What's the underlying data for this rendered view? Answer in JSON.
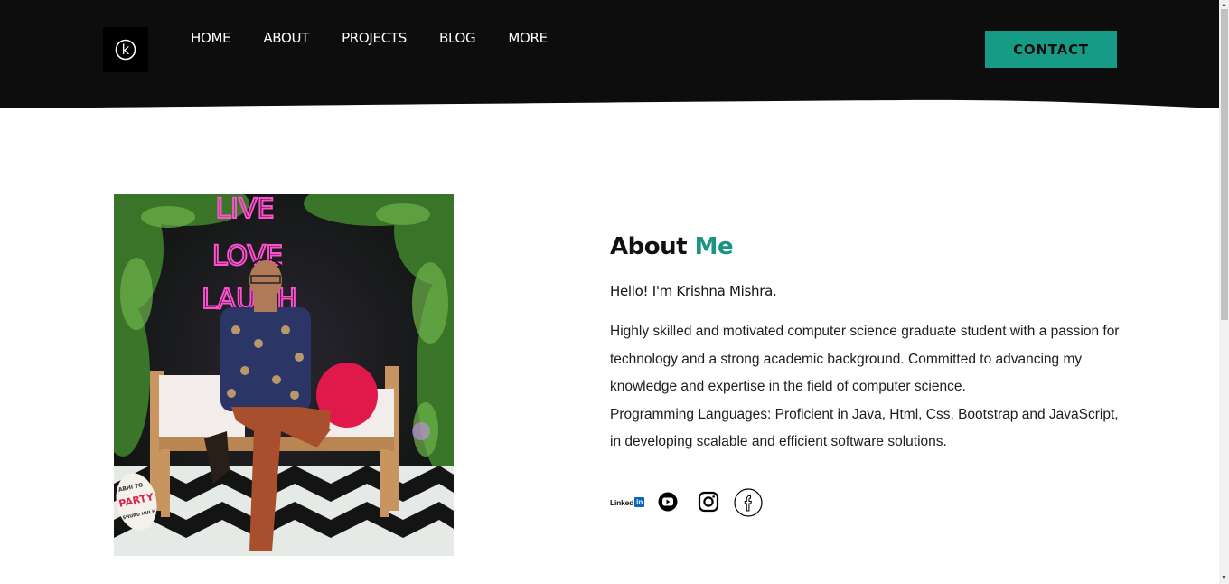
{
  "nav": {
    "logo_letter": "k",
    "items": [
      "HOME",
      "ABOUT",
      "PROJECTS",
      "BLOG",
      "MORE"
    ],
    "contact_label": "CONTACT"
  },
  "about": {
    "title_main": "About",
    "title_accent": "Me",
    "greeting": "Hello! I'm Krishna Mishra.",
    "bio_paragraph": "Highly skilled and motivated computer science graduate student with a passion for technology and a strong academic background. Committed to advancing my knowledge and expertise in the field of computer science.",
    "bio_languages": "Programming Languages: Proficient in Java, Html, Css, Bootstrap and JavaScript, in developing scalable and efficient software solutions."
  },
  "photo": {
    "neon_text": [
      "LIVE",
      "LOVE",
      "LAUGH"
    ],
    "sign_text": [
      "ABHI TO",
      "PARTY",
      "SHURU HUI H"
    ]
  },
  "social": {
    "linkedin_word": "Linked",
    "linkedin_badge": "in",
    "icons": [
      "linkedin-icon",
      "youtube-icon",
      "instagram-icon",
      "facebook-icon"
    ]
  },
  "colors": {
    "header_bg": "#0d0d0d",
    "accent": "#169c86",
    "title_accent": "#1c9482"
  }
}
